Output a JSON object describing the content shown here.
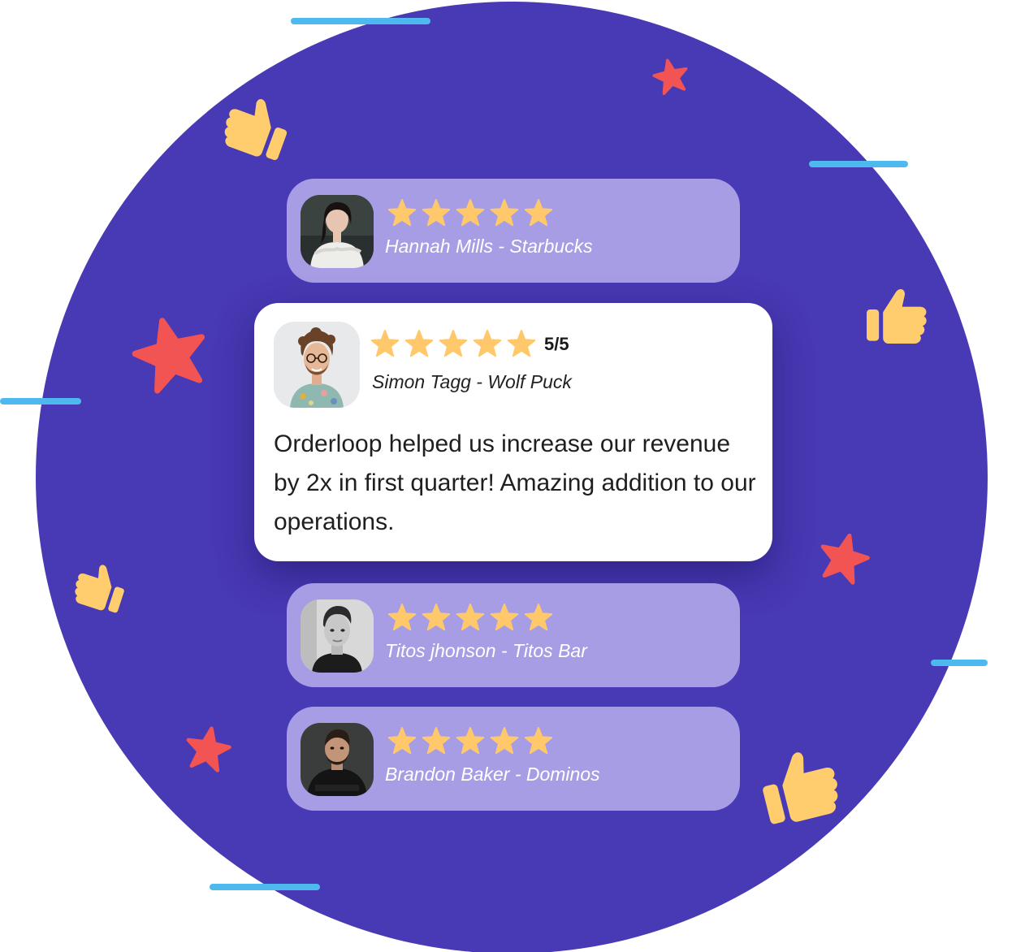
{
  "colors": {
    "circle": "#4839B4",
    "dash": "#4DB9EE",
    "star_rating": "#FFC96B",
    "star_deco": "#F25454",
    "thumb": "#FFCD6E",
    "small_card": "#A69DE5"
  },
  "decorations": {
    "stars_icon": "star-icon",
    "thumbs_icon": "thumbs-up-icon"
  },
  "testimonials": [
    {
      "author": "Hannah Mills - Starbucks",
      "rating": 5,
      "avatar": "avatar-photo"
    },
    {
      "author": "Simon Tagg - Wolf Puck",
      "rating": 5,
      "rating_text": "5/5",
      "quote": "Orderloop helped us increase our revenue by 2x in first quarter! Amazing addition to our operations.",
      "avatar": "avatar-photo",
      "featured": true
    },
    {
      "author": "Titos jhonson - Titos Bar",
      "rating": 5,
      "avatar": "avatar-photo"
    },
    {
      "author": "Brandon Baker - Dominos",
      "rating": 5,
      "avatar": "avatar-photo"
    }
  ]
}
